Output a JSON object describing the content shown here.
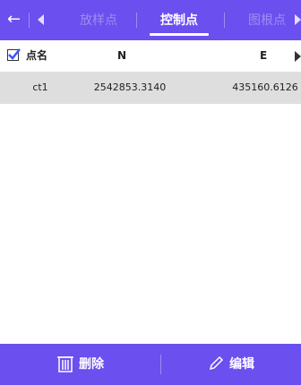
{
  "colors": {
    "accent": "#6b4fef",
    "selected_row": "#dedede"
  },
  "nav": {
    "back_icon": "back-arrow-icon",
    "tabs": [
      {
        "label": "放样点",
        "active": false
      },
      {
        "label": "控制点",
        "active": true
      },
      {
        "label": "图根点",
        "active": false
      }
    ]
  },
  "table": {
    "columns": [
      "点名",
      "N",
      "E"
    ],
    "rows": [
      {
        "name": "ct1",
        "n": "2542853.3140",
        "e": "435160.6126"
      }
    ]
  },
  "actions": {
    "delete_label": "删除",
    "edit_label": "编辑"
  }
}
